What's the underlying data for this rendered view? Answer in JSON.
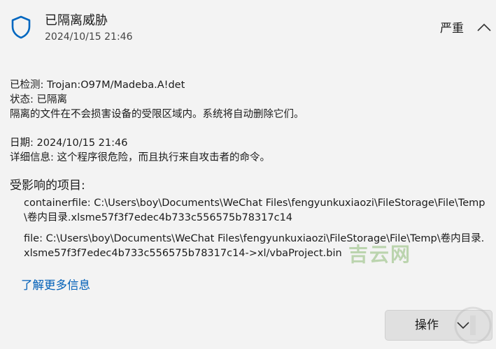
{
  "header": {
    "title": "已隔离威胁",
    "timestamp": "2024/10/15 21:46",
    "severity": "严重",
    "icons": {
      "status": "shield-icon",
      "collapse": "chevron-up-icon"
    },
    "accent_color": "#0067c0"
  },
  "details": {
    "detected_label": "已检测:",
    "detected_value": "Trojan:O97M/Madeba.A!det",
    "status_label": "状态:",
    "status_value": "已隔离",
    "description": "隔离的文件在不会损害设备的受限区域内。系统将自动删除它们。",
    "date_label": "日期:",
    "date_value": "2024/10/15 21:46",
    "info_label": "详细信息:",
    "info_value": "这个程序很危险，而且执行来自攻击者的命令。"
  },
  "affected": {
    "heading": "受影响的项目:",
    "items": [
      "containerfile: C:\\Users\\boy\\Documents\\WeChat Files\\fengyunkuxiaozi\\FileStorage\\File\\Temp\\卷内目录.xlsme57f3f7edec4b733c556575b78317c14",
      "file: C:\\Users\\boy\\Documents\\WeChat Files\\fengyunkuxiaozi\\FileStorage\\File\\Temp\\卷内目录.xlsme57f3f7edec4b733c556575b78317c14->xl/vbaProject.bin"
    ]
  },
  "learn_more": "了解更多信息",
  "watermark": "吉云网",
  "actions": {
    "label": "操作",
    "icon": "chevron-down-icon"
  }
}
